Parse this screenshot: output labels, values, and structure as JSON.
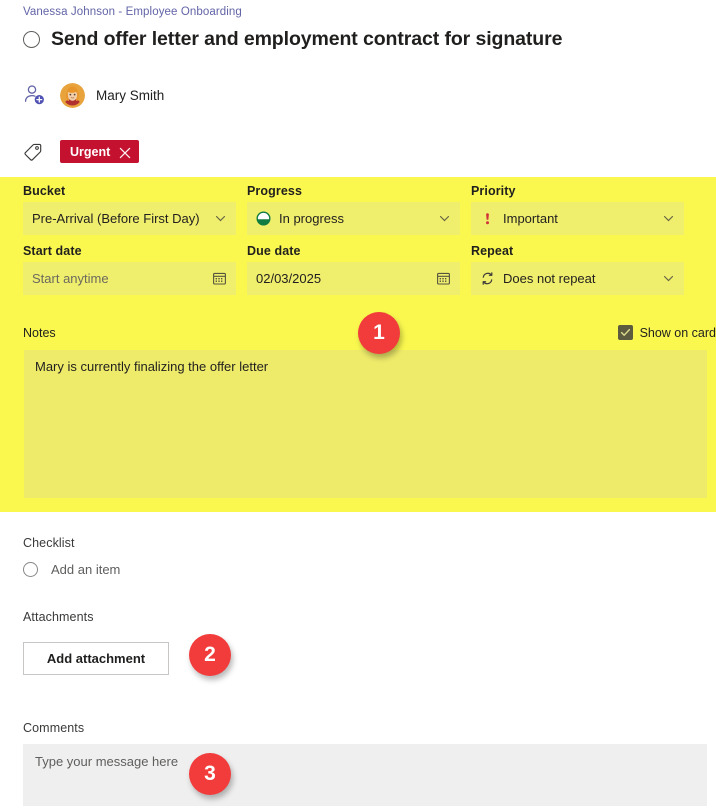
{
  "breadcrumb": "Vanessa Johnson - Employee Onboarding",
  "task": {
    "title": "Send offer letter and employment contract for signature",
    "completed": false
  },
  "assignee": {
    "name": "Mary Smith",
    "add_icon": "add-person-icon",
    "avatar_icon": "avatar"
  },
  "label": {
    "tag_icon": "tag-icon",
    "text": "Urgent",
    "remove_icon": "close-icon",
    "color": "#c4112f"
  },
  "fields": {
    "bucket": {
      "label": "Bucket",
      "value": "Pre-Arrival (Before First Day)"
    },
    "progress": {
      "label": "Progress",
      "value": "In progress",
      "icon": "progress-half-circle-icon",
      "icon_color": "#107c41"
    },
    "priority": {
      "label": "Priority",
      "value": "Important",
      "icon": "exclamation-icon",
      "icon_color": "#d13438"
    },
    "start_date": {
      "label": "Start date",
      "value": "",
      "placeholder": "Start anytime",
      "icon": "calendar-icon"
    },
    "due_date": {
      "label": "Due date",
      "value": "02/03/2025",
      "icon": "calendar-icon"
    },
    "repeat": {
      "label": "Repeat",
      "value": "Does not repeat",
      "icon": "repeat-icon"
    }
  },
  "notes": {
    "label": "Notes",
    "text": "Mary is currently finalizing the offer letter",
    "show_on_card_label": "Show on card",
    "show_on_card_checked": true
  },
  "checklist": {
    "label": "Checklist",
    "add_item_placeholder": "Add an item"
  },
  "attachments": {
    "label": "Attachments",
    "add_button": "Add attachment"
  },
  "comments": {
    "label": "Comments",
    "placeholder": "Type your message here"
  },
  "annotations": {
    "badge_1": "1",
    "badge_2": "2",
    "badge_3": "3",
    "color": "#f23b3b"
  },
  "colors": {
    "highlight": "#faf84f",
    "field_fill": "#f0ee6d",
    "notes_fill": "#eeeb6b",
    "breadcrumb": "#6264a7"
  }
}
